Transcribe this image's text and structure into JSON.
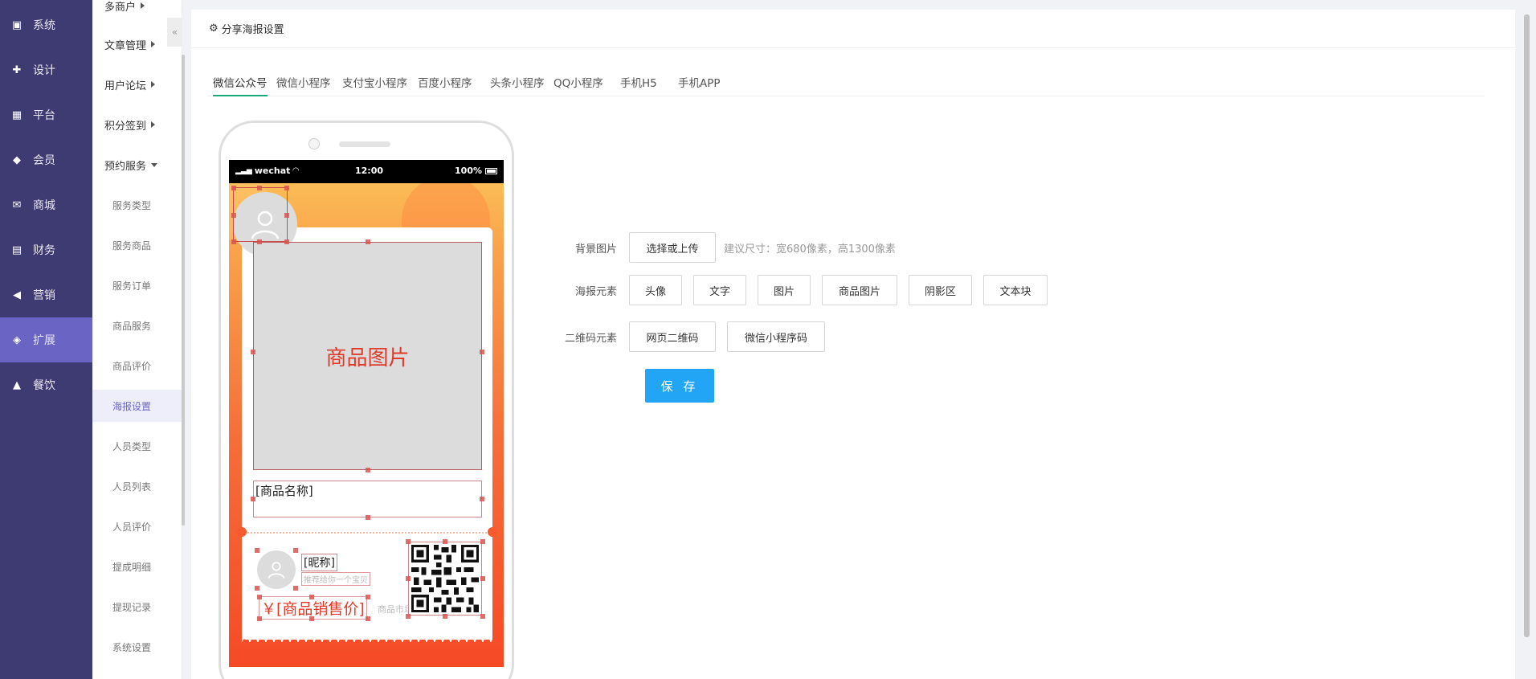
{
  "nav_primary": [
    {
      "label": "系统",
      "icon": "system-icon"
    },
    {
      "label": "设计",
      "icon": "puzzle-icon"
    },
    {
      "label": "平台",
      "icon": "grid-icon"
    },
    {
      "label": "会员",
      "icon": "diamond-icon"
    },
    {
      "label": "商城",
      "icon": "mail-icon"
    },
    {
      "label": "财务",
      "icon": "wallet-icon"
    },
    {
      "label": "营销",
      "icon": "megaphone-icon"
    },
    {
      "label": "扩展",
      "icon": "cube-icon"
    },
    {
      "label": "餐饮",
      "icon": "cloche-icon"
    }
  ],
  "nav_primary_active": "扩展",
  "nav_secondary": {
    "groups": [
      {
        "label": "多商户"
      },
      {
        "label": "文章管理"
      },
      {
        "label": "用户论坛"
      },
      {
        "label": "积分签到"
      },
      {
        "label": "预约服务"
      }
    ],
    "subitems": [
      "服务类型",
      "服务商品",
      "服务订单",
      "商品服务",
      "商品评价",
      "海报设置",
      "人员类型",
      "人员列表",
      "人员评价",
      "提成明细",
      "提现记录",
      "系统设置"
    ],
    "active": "海报设置",
    "collapse_label": "«"
  },
  "page_title": "分享海报设置",
  "tabs": [
    {
      "label": "微信公众号",
      "active": true
    },
    {
      "label": "微信小程序",
      "active": false
    },
    {
      "label": "支付宝小程序",
      "active": false
    },
    {
      "label": "百度小程序",
      "active": false
    },
    {
      "label": "头条小程序",
      "active": false
    },
    {
      "label": "QQ小程序",
      "active": false
    },
    {
      "label": "手机H5",
      "active": false
    },
    {
      "label": "手机APP",
      "active": false
    }
  ],
  "phone": {
    "status_left": "wechat",
    "status_time": "12:00",
    "status_battery": "100%",
    "goods_image_label": "商品图片",
    "goods_name_label": "[商品名称]",
    "nickname_label": "[昵称]",
    "recommend_text": "推荐给你一个宝贝",
    "price_label": "￥[商品销售价]",
    "original_price_label": "商品市场价"
  },
  "form": {
    "background": {
      "label": "背景图片",
      "button": "选择或上传",
      "hint": "建议尺寸：宽680像素，高1300像素"
    },
    "elements": {
      "label": "海报元素",
      "buttons": [
        "头像",
        "文字",
        "图片",
        "商品图片",
        "阴影区",
        "文本块"
      ]
    },
    "qrcode": {
      "label": "二维码元素",
      "buttons": [
        "网页二维码",
        "微信小程序码"
      ]
    },
    "save_label": "保 存"
  },
  "colors": {
    "nav_bg": "#3e3a72",
    "nav_active": "#6a64c4",
    "tab_underline": "#19a97b",
    "save_button": "#22a5f5",
    "poster_accent": "#e03b2a"
  }
}
